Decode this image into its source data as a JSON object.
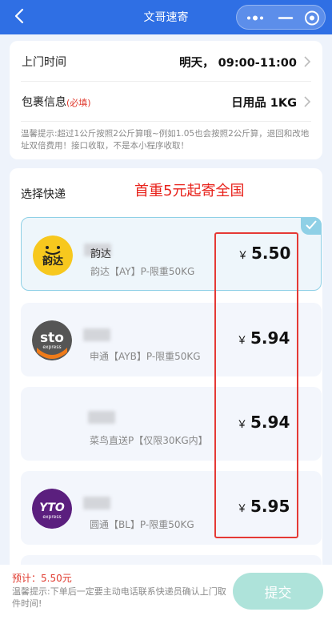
{
  "header": {
    "title": "文哥速寄"
  },
  "pickup": {
    "label": "上门时间",
    "value": "明天， 09:00-11:00"
  },
  "package": {
    "label": "包裹信息",
    "required": "(必填)",
    "value": "日用品 1KG"
  },
  "notice": "温馨提示:超过1公斤按照2公斤算哦~例如1.05也会按照2公斤算，退回和改地址双倍费用！接口收取，不是本小程序收取！",
  "courier_section": {
    "title": "选择快递",
    "promo": "首重5元起寄全国"
  },
  "couriers": [
    {
      "name": "韵达",
      "service": "韵达【AY】P-限重50KG",
      "currency": "￥",
      "price": "5.50",
      "selected": true,
      "logo_text": "韵达"
    },
    {
      "name": "",
      "service": "申通【AYB】P-限重50KG",
      "currency": "￥",
      "price": "5.94",
      "selected": false,
      "logo_text": "sto",
      "logo_sub": "express"
    },
    {
      "name": "",
      "service": "菜鸟直送P【仅限30KG内】",
      "currency": "￥",
      "price": "5.94",
      "selected": false
    },
    {
      "name": "",
      "service": "圆通【BL】P-限重50KG",
      "currency": "￥",
      "price": "5.95",
      "selected": false,
      "logo_text": "YTO",
      "logo_sub": "express"
    }
  ],
  "footer": {
    "estimate": "预计：5.50元",
    "tip": "温馨提示:下单后一定要主动电话联系快递员确认上门取件时间!",
    "submit": "提交"
  },
  "colors": {
    "primary": "#2f6fe4",
    "accent_red": "#e8231c",
    "submit": "#aee3da"
  }
}
